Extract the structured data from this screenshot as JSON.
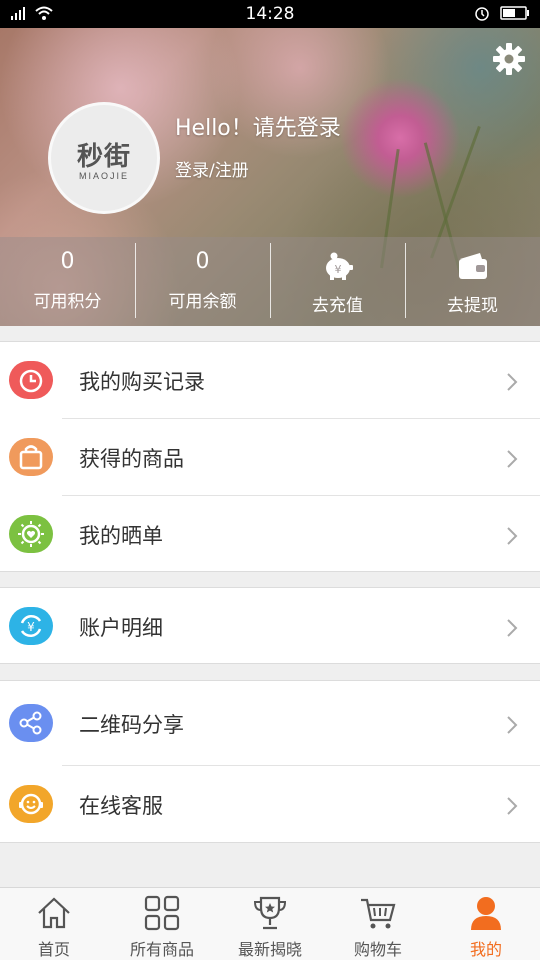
{
  "status_bar": {
    "time": "14:28"
  },
  "profile": {
    "greeting": "Hello！请先登录",
    "login_link": "登录/注册",
    "avatar_logo_text": "秒街",
    "avatar_logo_sub": "MIAOJIE"
  },
  "stats": [
    {
      "value": "0",
      "label": "可用积分"
    },
    {
      "value": "0",
      "label": "可用余额"
    },
    {
      "label": "去充值",
      "icon": "piggy-bank-icon"
    },
    {
      "label": "去提现",
      "icon": "wallet-icon"
    }
  ],
  "menu": {
    "group1": [
      {
        "label": "我的购买记录",
        "icon": "clock-icon",
        "color": "#ef5a5a"
      },
      {
        "label": "获得的商品",
        "icon": "bag-icon",
        "color": "#f09a5c"
      },
      {
        "label": "我的晒单",
        "icon": "sun-heart-icon",
        "color": "#7cc141"
      }
    ],
    "group2": [
      {
        "label": "账户明细",
        "icon": "yen-refresh-icon",
        "color": "#2db3e6"
      }
    ],
    "group3": [
      {
        "label": "二维码分享",
        "icon": "share-icon",
        "color": "#6a8ff0"
      },
      {
        "label": "在线客服",
        "icon": "headset-icon",
        "color": "#f2a62a"
      }
    ]
  },
  "tabbar": {
    "tabs": [
      {
        "label": "首页",
        "icon": "home-icon"
      },
      {
        "label": "所有商品",
        "icon": "grid-icon"
      },
      {
        "label": "最新揭晓",
        "icon": "trophy-icon"
      },
      {
        "label": "购物车",
        "icon": "cart-icon"
      },
      {
        "label": "我的",
        "icon": "user-icon",
        "active": true
      }
    ],
    "active_color": "#f26d1f"
  }
}
